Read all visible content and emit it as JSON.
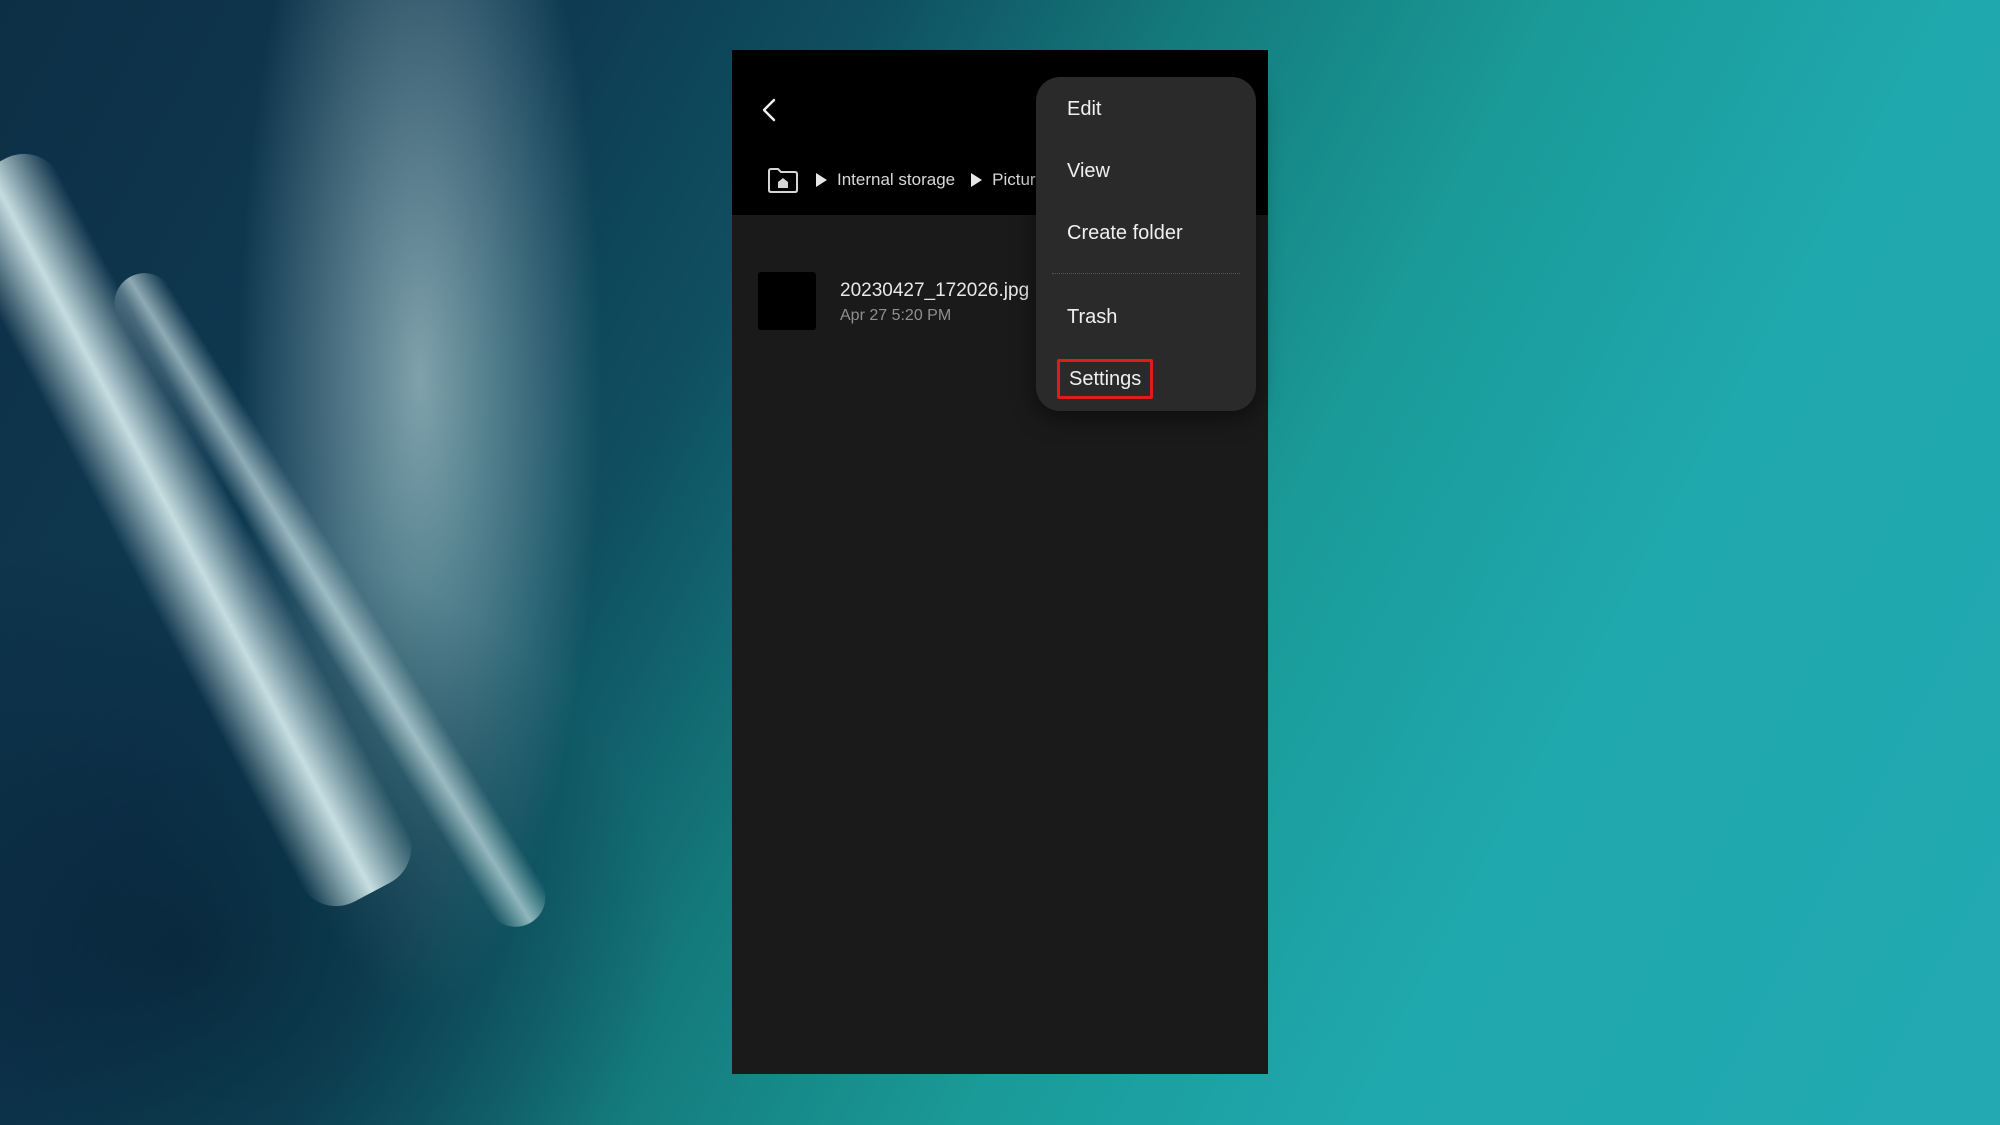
{
  "app": {
    "breadcrumb": {
      "items": [
        "Internal storage",
        "Pictur"
      ]
    },
    "files": [
      {
        "name": "20230427_172026.jpg",
        "date": "Apr 27 5:20 PM"
      }
    ],
    "menu": {
      "items": [
        {
          "label": "Edit"
        },
        {
          "label": "View"
        },
        {
          "label": "Create folder"
        },
        {
          "label": "Trash"
        },
        {
          "label": "Settings",
          "highlighted": true
        }
      ]
    },
    "icons": {
      "back": "back-arrow-icon",
      "home": "home-folder-icon",
      "separator": "triangle-right-icon"
    },
    "colors": {
      "highlight": "#e01b1b",
      "background": "#1a1a1a",
      "header": "#000000",
      "menu": "#2a2a2a"
    }
  }
}
